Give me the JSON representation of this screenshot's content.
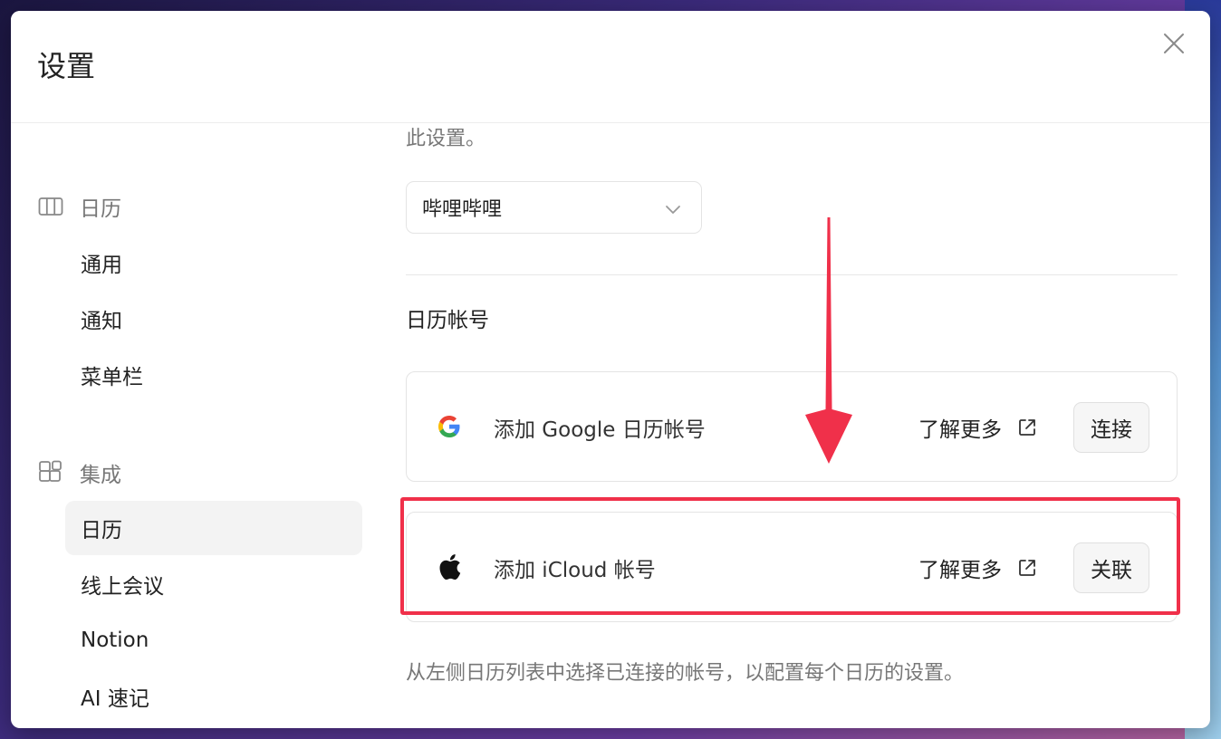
{
  "dialog": {
    "title": "设置"
  },
  "sidebar": {
    "groups": [
      {
        "label": "日历",
        "icon": "calendar-columns-icon",
        "items": [
          {
            "label": "通用"
          },
          {
            "label": "通知"
          },
          {
            "label": "菜单栏"
          }
        ]
      },
      {
        "label": "集成",
        "icon": "integrations-grid-icon",
        "items": [
          {
            "label": "日历",
            "active": true
          },
          {
            "label": "线上会议"
          },
          {
            "label": "Notion"
          },
          {
            "label": "AI 速记"
          }
        ]
      }
    ]
  },
  "content": {
    "cut_text": "此设置。",
    "select_value": "哔哩哔哩",
    "section_title": "日历帐号",
    "accounts": [
      {
        "icon": "google-icon",
        "label": "添加 Google 日历帐号",
        "learn_more": "了解更多",
        "button": "连接"
      },
      {
        "icon": "apple-icon",
        "label": "添加 iCloud 帐号",
        "learn_more": "了解更多",
        "button": "关联"
      }
    ],
    "footnote": "从左侧日历列表中选择已连接的帐号，以配置每个日历的设置。"
  },
  "colors": {
    "accent_annotation": "#f0304a",
    "active_nav_bg": "#f3f3f3",
    "muted_text": "#777777"
  }
}
